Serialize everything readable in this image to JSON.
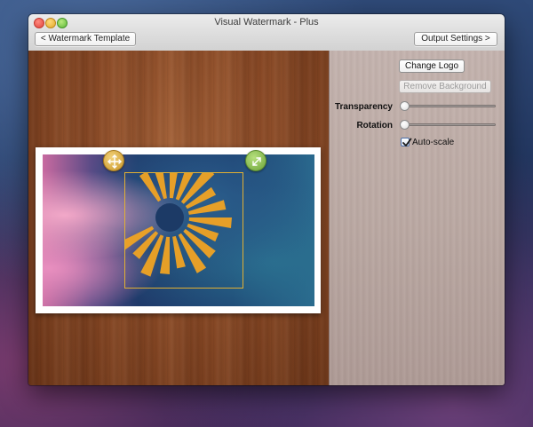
{
  "window": {
    "title": "Visual Watermark - Plus"
  },
  "toolbar": {
    "back_label": "< Watermark Template",
    "next_label": "Output Settings >"
  },
  "controls": {
    "change_logo_label": "Change Logo",
    "remove_background_label": "Remove Background",
    "transparency_label": "Transparency",
    "transparency_value": 0,
    "rotation_label": "Rotation",
    "rotation_value": 0,
    "autoscale_label": "Auto-scale",
    "autoscale_checked": true
  },
  "icons": {
    "move_handle": "move-arrows-icon",
    "scale_handle": "resize-arrows-icon",
    "logo": "sunburst-logo"
  },
  "colors": {
    "logo_orange": "#f0a323",
    "selection_border": "#e2b033"
  }
}
